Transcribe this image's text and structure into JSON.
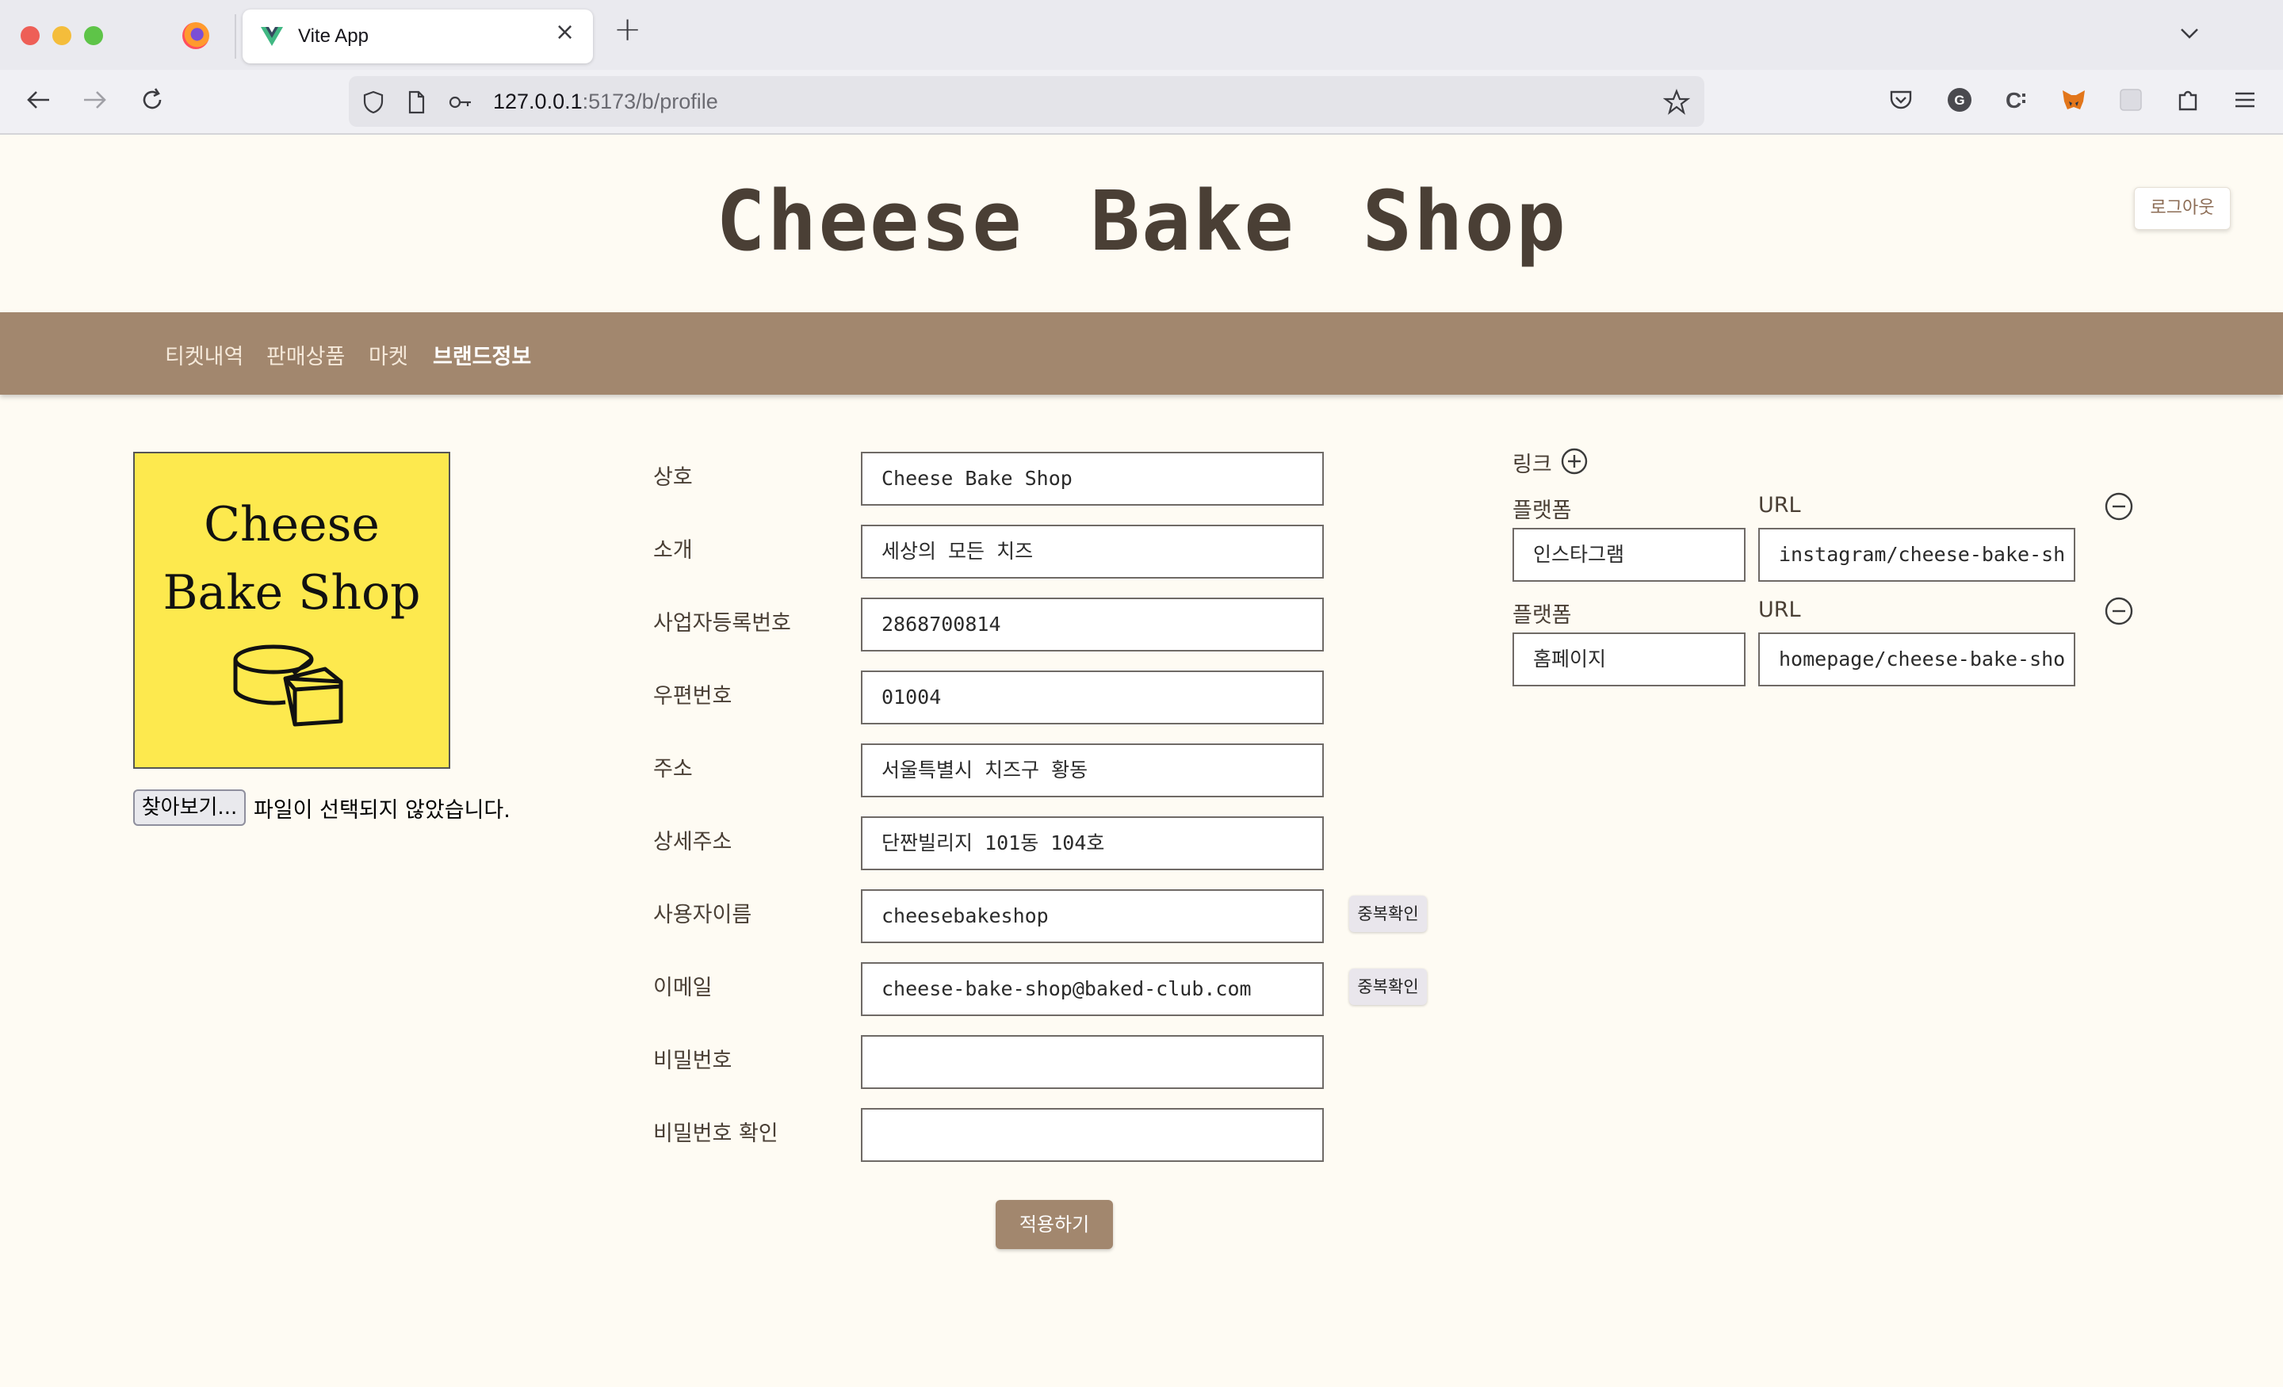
{
  "browser": {
    "tab_title": "Vite App",
    "url_host": "127.0.0.1",
    "url_rest": ":5173/b/profile",
    "icons": [
      "firefox-icon",
      "vite-icon",
      "back-icon",
      "forward-icon",
      "reload-icon",
      "shield-icon",
      "page-icon",
      "key-icon",
      "star-icon",
      "pocket-icon",
      "grammarly-icon",
      "extension-c-icon",
      "metamask-icon",
      "extension-icon",
      "puzzle-icon",
      "menu-icon"
    ]
  },
  "header": {
    "site_title": "Cheese Bake Shop",
    "logout_label": "로그아웃"
  },
  "nav": {
    "items": [
      {
        "label": "티켓내역"
      },
      {
        "label": "판매상품"
      },
      {
        "label": "마켓"
      },
      {
        "label": "브랜드정보"
      }
    ],
    "active_index": 3
  },
  "logo": {
    "line1": "Cheese",
    "line2": "Bake Shop"
  },
  "file_input": {
    "button_label": "찾아보기...",
    "status": "파일이 선택되지 않았습니다."
  },
  "form": {
    "fields": [
      {
        "label": "상호",
        "value": "Cheese Bake Shop"
      },
      {
        "label": "소개",
        "value": "세상의 모든 치즈"
      },
      {
        "label": "사업자등록번호",
        "value": "2868700814"
      },
      {
        "label": "우편번호",
        "value": "01004"
      },
      {
        "label": "주소",
        "value": "서울특별시 치즈구 황동"
      },
      {
        "label": "상세주소",
        "value": "단짠빌리지 101동 104호"
      },
      {
        "label": "사용자이름",
        "value": "cheesebakeshop",
        "dup_check": "중복확인"
      },
      {
        "label": "이메일",
        "value": "cheese-bake-shop@baked-club.com",
        "dup_check": "중복확인"
      },
      {
        "label": "비밀번호",
        "value": ""
      },
      {
        "label": "비밀번호 확인",
        "value": ""
      }
    ],
    "submit_label": "적용하기"
  },
  "links": {
    "title": "링크",
    "platform_label": "플랫폼",
    "url_label": "URL",
    "rows": [
      {
        "platform": "인스타그램",
        "url": "instagram/cheese-bake-sh"
      },
      {
        "platform": "홈페이지",
        "url": "homepage/cheese-bake-sho"
      }
    ]
  },
  "colors": {
    "nav_bg": "#a2876e",
    "page_bg": "#fefbf3",
    "logo_bg": "#fde94e",
    "title_text": "#4a3f35"
  }
}
